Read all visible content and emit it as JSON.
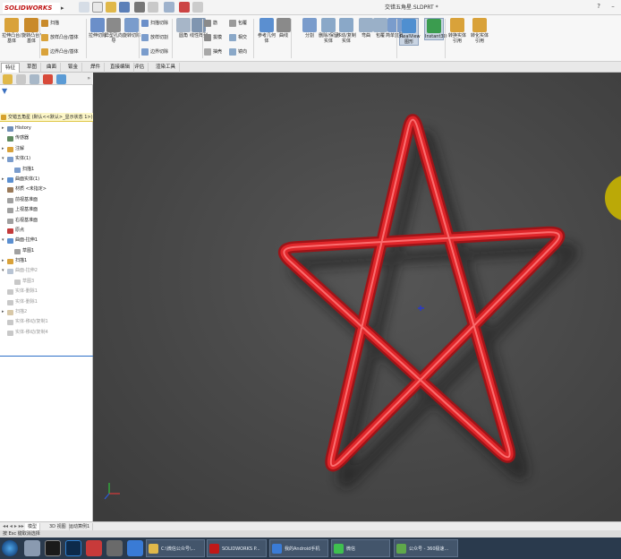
{
  "app": {
    "logo_text": "SOLIDWORKS",
    "doc_title": "交错五角星.SLDPRT *"
  },
  "ribbon": {
    "big_buttons": [
      {
        "label": "拉伸凸台/基体",
        "icon": "extrude-boss-icon",
        "color": "#d9a23a"
      },
      {
        "label": "旋转凸台/基体",
        "icon": "revolve-boss-icon",
        "color": "#c98a2a"
      },
      {
        "label": "拉伸切除",
        "icon": "extrude-cut-icon",
        "color": "#6b8fc9"
      },
      {
        "label": "异型孔向导",
        "icon": "hole-wizard-icon",
        "color": "#8a8a8a"
      },
      {
        "label": "旋转切除",
        "icon": "revolve-cut-icon",
        "color": "#7a9ccc"
      },
      {
        "label": "圆角",
        "icon": "fillet-icon",
        "color": "#a7b6c8"
      },
      {
        "label": "线性阵列",
        "icon": "linear-pattern-icon",
        "color": "#7f95b0"
      },
      {
        "label": "参考几何体",
        "icon": "reference-geometry-icon",
        "color": "#5b8fd0"
      },
      {
        "label": "曲线",
        "icon": "curves-icon",
        "color": "#8a8a8a"
      },
      {
        "label": "Instant3D",
        "icon": "instant3d-icon",
        "color": "#3b9c4f"
      }
    ],
    "small_buttons": [
      {
        "label": "扫描",
        "icon": "sweep-icon"
      },
      {
        "label": "放样凸台/基体",
        "icon": "loft-boss-icon"
      },
      {
        "label": "边界凸台/基体",
        "icon": "boundary-boss-icon"
      },
      {
        "label": "扫描切除",
        "icon": "swept-cut-icon"
      },
      {
        "label": "放样切割",
        "icon": "lofted-cut-icon"
      },
      {
        "label": "边界切除",
        "icon": "boundary-cut-icon"
      },
      {
        "label": "筋",
        "icon": "rib-icon"
      },
      {
        "label": "拔模",
        "icon": "draft-icon"
      },
      {
        "label": "抽壳",
        "icon": "shell-icon"
      },
      {
        "label": "包覆",
        "icon": "wrap-icon"
      },
      {
        "label": "相交",
        "icon": "intersect-icon"
      },
      {
        "label": "镜向",
        "icon": "mirror-icon"
      }
    ],
    "right_buttons": [
      {
        "label": "RealView图形",
        "icon": "realview-icon"
      },
      {
        "label": "分割",
        "icon": "split-icon"
      },
      {
        "label": "删除/保留实体",
        "icon": "delete-body-icon"
      },
      {
        "label": "移动/复制实体",
        "icon": "move-copy-body-icon"
      },
      {
        "label": "弯曲",
        "icon": "flex-icon"
      },
      {
        "label": "包覆",
        "icon": "wrap2-icon"
      },
      {
        "label": "简单直孔",
        "icon": "simple-hole-icon"
      },
      {
        "label": "转换实体引用",
        "icon": "convert-entities-icon"
      },
      {
        "label": "转化实体引用",
        "icon": "convert-icon"
      }
    ]
  },
  "tabs": [
    "特征",
    "草图",
    "曲面",
    "钣金",
    "焊件",
    "直接编辑",
    "评估",
    "渲染工具"
  ],
  "left_panel": {
    "root_label": "交错五角星 (默认<<默认>_显示状态 1>)",
    "items": [
      {
        "label": "History",
        "indent": 1,
        "arrow": "▸",
        "icon": "history-icon",
        "color": "#6f8fb8",
        "dim": false
      },
      {
        "label": "传感器",
        "indent": 1,
        "arrow": "",
        "icon": "sensor-icon",
        "color": "#5f8a5f",
        "dim": false
      },
      {
        "label": "注解",
        "indent": 1,
        "arrow": "▸",
        "icon": "annotations-icon",
        "color": "#d9a23a",
        "dim": false
      },
      {
        "label": "实体(1)",
        "indent": 1,
        "arrow": "▾",
        "icon": "solid-bodies-icon",
        "color": "#7a9ccc",
        "dim": false
      },
      {
        "label": "扫描1",
        "indent": 2,
        "arrow": "",
        "icon": "sweep-body-icon",
        "color": "#7a9ccc",
        "dim": false
      },
      {
        "label": "曲面实体(1)",
        "indent": 1,
        "arrow": "▸",
        "icon": "surface-bodies-icon",
        "color": "#5b8fd0",
        "dim": false
      },
      {
        "label": "材质 <未指定>",
        "indent": 1,
        "arrow": "",
        "icon": "material-icon",
        "color": "#9a7a5a",
        "dim": false
      },
      {
        "label": "前视基准面",
        "indent": 1,
        "arrow": "",
        "icon": "plane-icon",
        "color": "#a0a0a0",
        "dim": false
      },
      {
        "label": "上视基准面",
        "indent": 1,
        "arrow": "",
        "icon": "plane-icon",
        "color": "#a0a0a0",
        "dim": false
      },
      {
        "label": "右视基准面",
        "indent": 1,
        "arrow": "",
        "icon": "plane-icon",
        "color": "#a0a0a0",
        "dim": false
      },
      {
        "label": "原点",
        "indent": 1,
        "arrow": "",
        "icon": "origin-icon",
        "color": "#c43a3a",
        "dim": false
      },
      {
        "label": "曲面-拉伸1",
        "indent": 1,
        "arrow": "▾",
        "icon": "surface-extrude-icon",
        "color": "#5b8fd0",
        "dim": false
      },
      {
        "label": "草图1",
        "indent": 2,
        "arrow": "",
        "icon": "sketch-icon",
        "color": "#a0a0a0",
        "dim": false
      },
      {
        "label": "扫描1",
        "indent": 1,
        "arrow": "▸",
        "icon": "sweep-feature-icon",
        "color": "#d9a23a",
        "dim": false
      },
      {
        "label": "曲面-拉伸2",
        "indent": 1,
        "arrow": "▾",
        "icon": "surface-extrude-icon",
        "color": "#b8c4d4",
        "dim": true
      },
      {
        "label": "草图3",
        "indent": 2,
        "arrow": "",
        "icon": "sketch-icon",
        "color": "#c8c8c8",
        "dim": true
      },
      {
        "label": "实体-删除1",
        "indent": 1,
        "arrow": "",
        "icon": "delete-body-icon",
        "color": "#c8c8c8",
        "dim": true
      },
      {
        "label": "实体-删除1",
        "indent": 1,
        "arrow": "",
        "icon": "delete-body-icon",
        "color": "#c8c8c8",
        "dim": true
      },
      {
        "label": "扫描2",
        "indent": 1,
        "arrow": "▸",
        "icon": "sweep-feature-icon",
        "color": "#d8c8a8",
        "dim": true
      },
      {
        "label": "实体-移动/复制1",
        "indent": 1,
        "arrow": "",
        "icon": "move-copy-icon",
        "color": "#c8c8c8",
        "dim": true
      },
      {
        "label": "实体-移动/复制4",
        "indent": 1,
        "arrow": "",
        "icon": "move-copy-icon",
        "color": "#c8c8c8",
        "dim": true
      }
    ]
  },
  "bottom_tabs": [
    "模型",
    "3D 视图",
    "运动算例1"
  ],
  "status_text": "按 Esc 键取消选择",
  "taskbar": {
    "items": [
      {
        "label": "C:\\微信公众号\\...",
        "icon": "folder-icon",
        "color": "#e0b84a"
      },
      {
        "label": "SOLIDWORKS P...",
        "icon": "solidworks-icon",
        "color": "#c01818"
      },
      {
        "label": "我的Android手机",
        "icon": "phone-icon",
        "color": "#3a7bd5"
      },
      {
        "label": "微信",
        "icon": "wechat-icon",
        "color": "#3fbf4f"
      },
      {
        "label": "公众号 - 360极速...",
        "icon": "browser-icon",
        "color": "#5fa84a"
      }
    ]
  },
  "colors": {
    "star": "#e0262a",
    "star_highlight": "#ff7a7a",
    "viewport_bg": "#4a4a4a",
    "tree_selected": "#fdf7c8"
  }
}
